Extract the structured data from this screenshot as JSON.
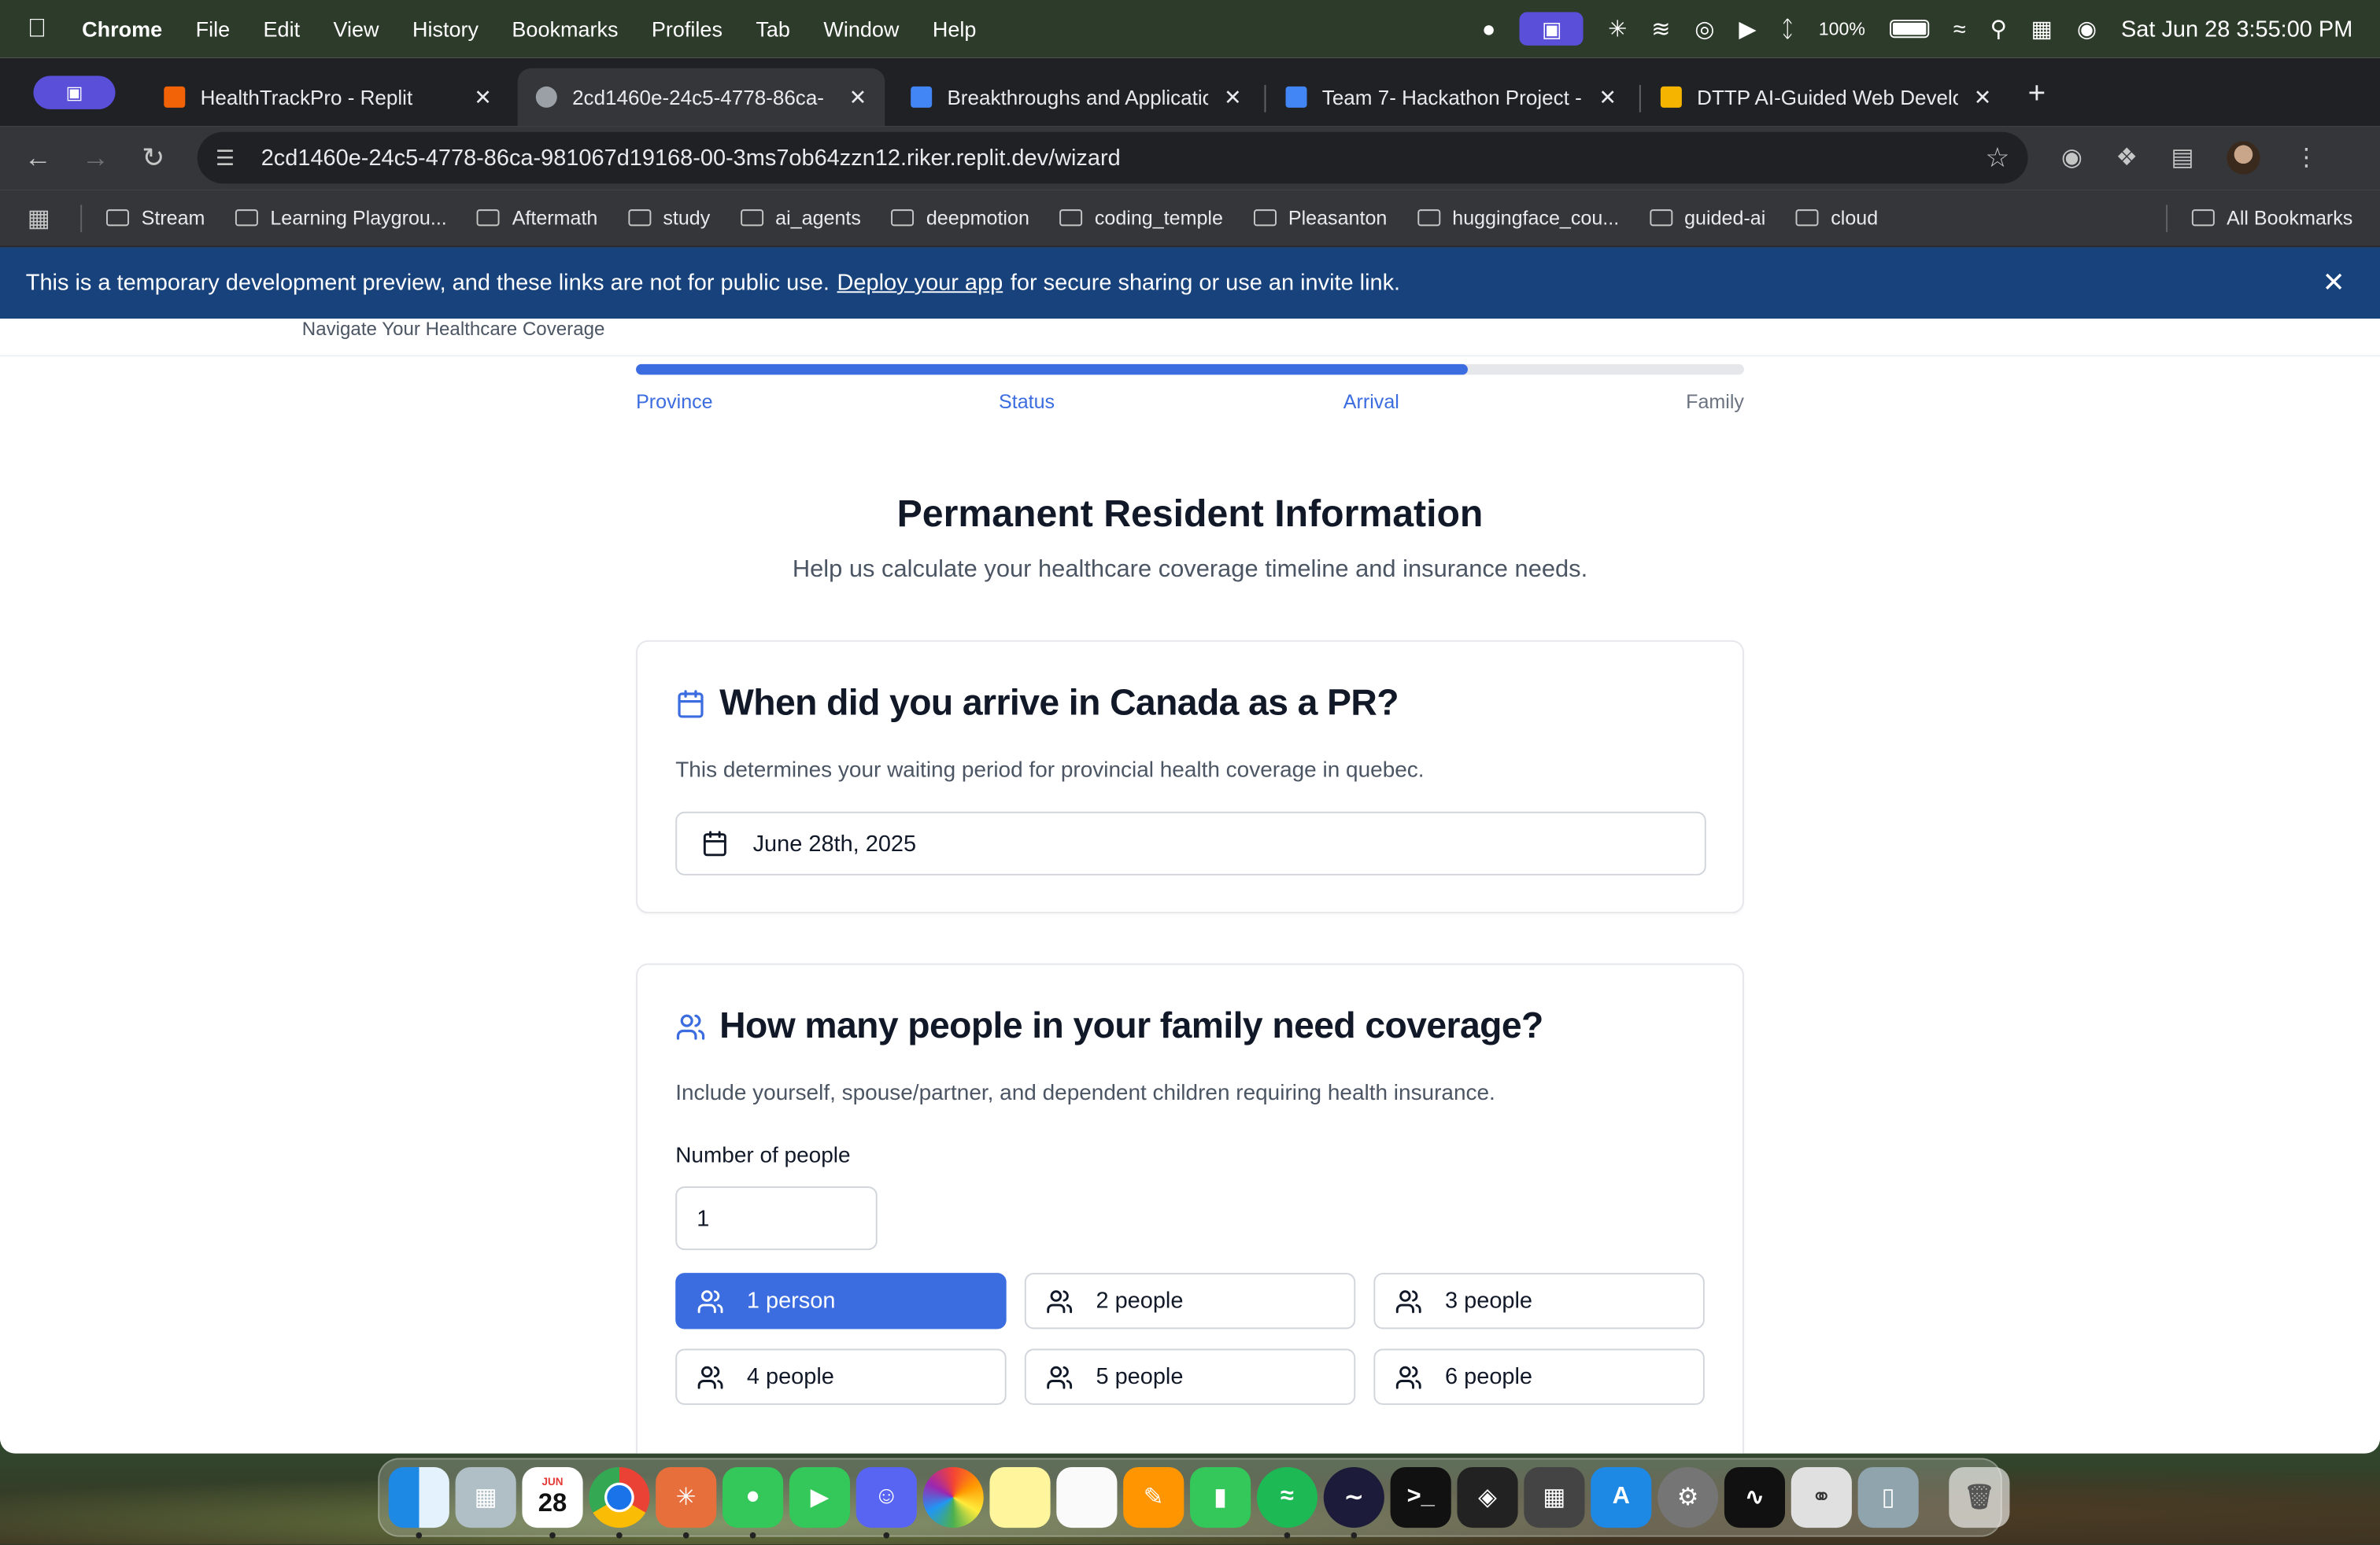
{
  "menubar": {
    "app_name": "Chrome",
    "menus": [
      "File",
      "Edit",
      "View",
      "History",
      "Bookmarks",
      "Profiles",
      "Tab",
      "Window",
      "Help"
    ],
    "battery": "100%",
    "datetime": "Sat Jun 28  3:55:00 PM"
  },
  "tabs": [
    {
      "title": "HealthTrackPro - Replit",
      "favicon_color": "#f26207",
      "active": false
    },
    {
      "title": "2cd1460e-24c5-4778-86ca-",
      "favicon_color": "#9aa0a6",
      "active": true
    },
    {
      "title": "Breakthroughs and Applicatio",
      "favicon_color": "#4285f4",
      "active": false
    },
    {
      "title": "Team 7- Hackathon Project -",
      "favicon_color": "#4285f4",
      "active": false
    },
    {
      "title": "DTTP AI-Guided Web Develop",
      "favicon_color": "#f4b400",
      "active": false
    }
  ],
  "address_bar": {
    "url": "2cd1460e-24c5-4778-86ca-981067d19168-00-3ms7ob64zzn12.riker.replit.dev/wizard"
  },
  "bookmarks": {
    "items": [
      "Stream",
      "Learning Playgrou...",
      "Aftermath",
      "study",
      "ai_agents",
      "deepmotion",
      "coding_temple",
      "Pleasanton",
      "huggingface_cou...",
      "guided-ai",
      "cloud"
    ],
    "all_label": "All Bookmarks"
  },
  "banner": {
    "text_before": "This is a temporary development preview, and these links are not for public use.",
    "link": "Deploy your app",
    "text_after": "for secure sharing or use an invite link."
  },
  "header": {
    "tagline": "Navigate Your Healthcare Coverage"
  },
  "progress": {
    "percent": 75,
    "steps": [
      {
        "label": "Province",
        "state": "done"
      },
      {
        "label": "Status",
        "state": "done"
      },
      {
        "label": "Arrival",
        "state": "done"
      },
      {
        "label": "Family",
        "state": "todo"
      }
    ]
  },
  "page": {
    "title": "Permanent Resident Information",
    "subtitle": "Help us calculate your healthcare coverage timeline and insurance needs."
  },
  "arrival_card": {
    "question": "When did you arrive in Canada as a PR?",
    "description": "This determines your waiting period for provincial health coverage in quebec.",
    "date_value": "June 28th, 2025"
  },
  "family_card": {
    "question": "How many people in your family need coverage?",
    "description": "Include yourself, spouse/partner, and dependent children requiring health insurance.",
    "number_label": "Number of people",
    "number_value": "1",
    "options": [
      {
        "label": "1 person",
        "selected": true
      },
      {
        "label": "2 people",
        "selected": false
      },
      {
        "label": "3 people",
        "selected": false
      },
      {
        "label": "4 people",
        "selected": false
      },
      {
        "label": "5 people",
        "selected": false
      },
      {
        "label": "6 people",
        "selected": false
      }
    ]
  },
  "colors": {
    "accent": "#3b6ce0",
    "banner": "#17427c"
  },
  "dock": {
    "calendar_month": "JUN",
    "calendar_day": "28"
  }
}
